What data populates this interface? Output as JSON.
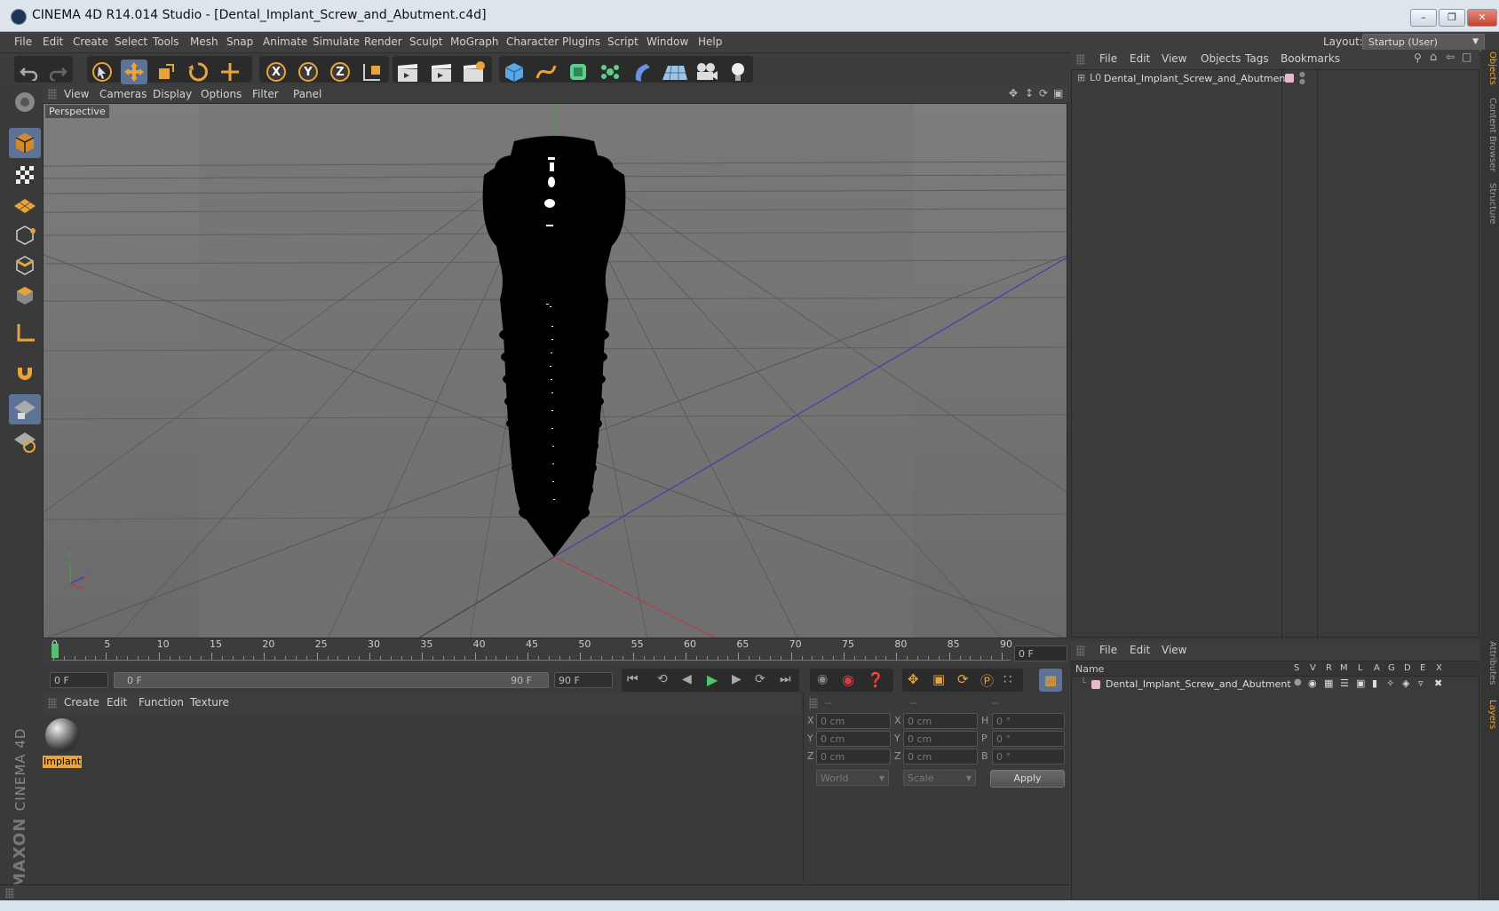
{
  "window": {
    "title": "CINEMA 4D R14.014 Studio - [Dental_Implant_Screw_and_Abutment.c4d]"
  },
  "menubar": {
    "items": [
      "File",
      "Edit",
      "Create",
      "Select",
      "Tools",
      "Mesh",
      "Snap",
      "Animate",
      "Simulate",
      "Render",
      "Sculpt",
      "MoGraph",
      "Character",
      "Plugins",
      "Script",
      "Window",
      "Help"
    ],
    "layout_label": "Layout:",
    "layout_value": "Startup (User)"
  },
  "toolbar": {
    "axis_x": "X",
    "axis_y": "Y",
    "axis_z": "Z"
  },
  "viewport": {
    "menu": [
      "View",
      "Cameras",
      "Display",
      "Options",
      "Filter",
      "Panel"
    ],
    "label": "Perspective",
    "axis_y": "Y",
    "axis_z": "Z",
    "axis_x": "X"
  },
  "timeline": {
    "ticks": [
      "0",
      "5",
      "10",
      "15",
      "20",
      "25",
      "30",
      "35",
      "40",
      "45",
      "50",
      "55",
      "60",
      "65",
      "70",
      "75",
      "80",
      "85",
      "90"
    ],
    "current_frame_right": "0 F",
    "start_field": "0 F",
    "slider_left": "0 F",
    "slider_right": "90 F",
    "end_field": "90 F"
  },
  "material_manager": {
    "menu": [
      "Create",
      "Edit",
      "Function",
      "Texture"
    ],
    "materials": [
      {
        "name": "Implant"
      }
    ]
  },
  "coordinates": {
    "headers": [
      "--",
      "--",
      "--"
    ],
    "rows": [
      {
        "a_label": "X",
        "a_value": "0 cm",
        "b_label": "X",
        "b_value": "0 cm",
        "c_label": "H",
        "c_value": "0 °"
      },
      {
        "a_label": "Y",
        "a_value": "0 cm",
        "b_label": "Y",
        "b_value": "0 cm",
        "c_label": "P",
        "c_value": "0 °"
      },
      {
        "a_label": "Z",
        "a_value": "0 cm",
        "b_label": "Z",
        "b_value": "0 cm",
        "c_label": "B",
        "c_value": "0 °"
      }
    ],
    "space_select": "World",
    "mode_select": "Scale",
    "apply": "Apply"
  },
  "object_manager": {
    "menu": [
      "File",
      "Edit",
      "View",
      "Objects",
      "Tags",
      "Bookmarks"
    ],
    "objects": [
      {
        "name": "Dental_Implant_Screw_and_Abutment"
      }
    ]
  },
  "layer_manager": {
    "menu": [
      "File",
      "Edit",
      "View"
    ],
    "columns": [
      "Name",
      "S",
      "V",
      "R",
      "M",
      "L",
      "A",
      "G",
      "D",
      "E",
      "X"
    ],
    "rows": [
      {
        "name": "Dental_Implant_Screw_and_Abutment"
      }
    ]
  },
  "side_tabs": [
    "Objects",
    "Content Browser",
    "Structure",
    "Attributes",
    "Layers"
  ],
  "branding": {
    "maxon": "MAXON",
    "product": "CINEMA 4D"
  },
  "colors": {
    "accent_orange": "#e8a33a",
    "active_blue": "#5d7396",
    "viewport_bg": "#6b6b6b"
  }
}
